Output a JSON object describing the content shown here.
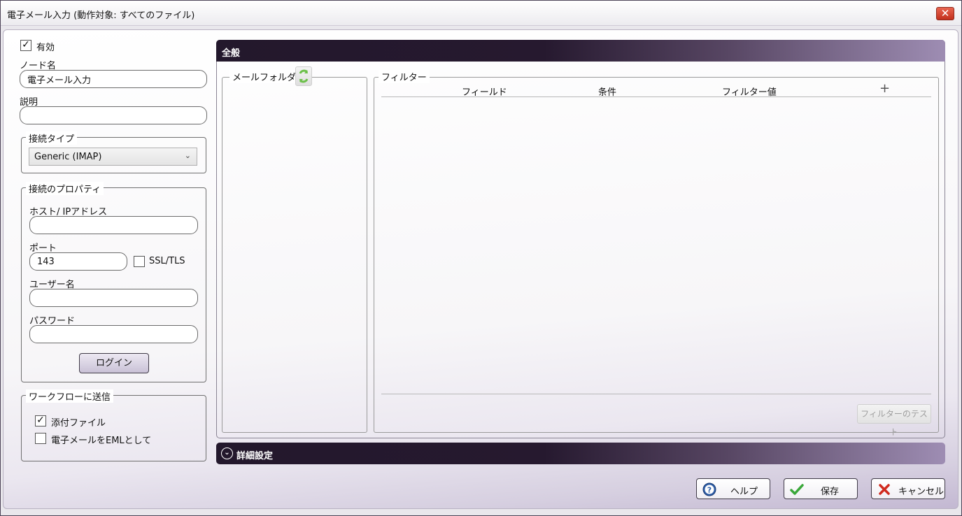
{
  "window": {
    "title": "電子メール入力 (動作対象: すべてのファイル)",
    "close_symbol": "✕"
  },
  "left": {
    "enabled_label": "有効",
    "enabled_checked": true,
    "node_name_label": "ノード名",
    "node_name_value": "電子メール入力",
    "description_label": "説明",
    "description_value": "",
    "connection_type": {
      "legend": "接続タイプ",
      "selected": "Generic (IMAP)"
    },
    "connection_props": {
      "legend": "接続のプロパティ",
      "host_label": "ホスト/ IPアドレス",
      "host_value": "",
      "port_label": "ポート",
      "port_value": "143",
      "ssl_label": "SSL/TLS",
      "ssl_checked": false,
      "username_label": "ユーザー名",
      "username_value": "",
      "password_label": "パスワード",
      "password_value": "",
      "login_button": "ログイン"
    },
    "send_to_workflow": {
      "legend": "ワークフローに送信",
      "attachments_label": "添付ファイル",
      "attachments_checked": true,
      "eml_label": "電子メールをEMLとして",
      "eml_checked": false
    }
  },
  "general": {
    "header": "全般",
    "mail_folder_legend": "メールフォルダー",
    "filter_legend": "フィルター",
    "columns": [
      "フィールド",
      "条件",
      "フィルター値"
    ],
    "add_symbol": "+",
    "test_filter_button": "フィルターのテスト"
  },
  "advanced": {
    "header": "詳細設定"
  },
  "footer": {
    "help": "ヘルプ",
    "save": "保存",
    "cancel": "キャンセル"
  },
  "colors": {
    "accent_dark": "#23182c",
    "accent_light": "#9e8db3"
  }
}
